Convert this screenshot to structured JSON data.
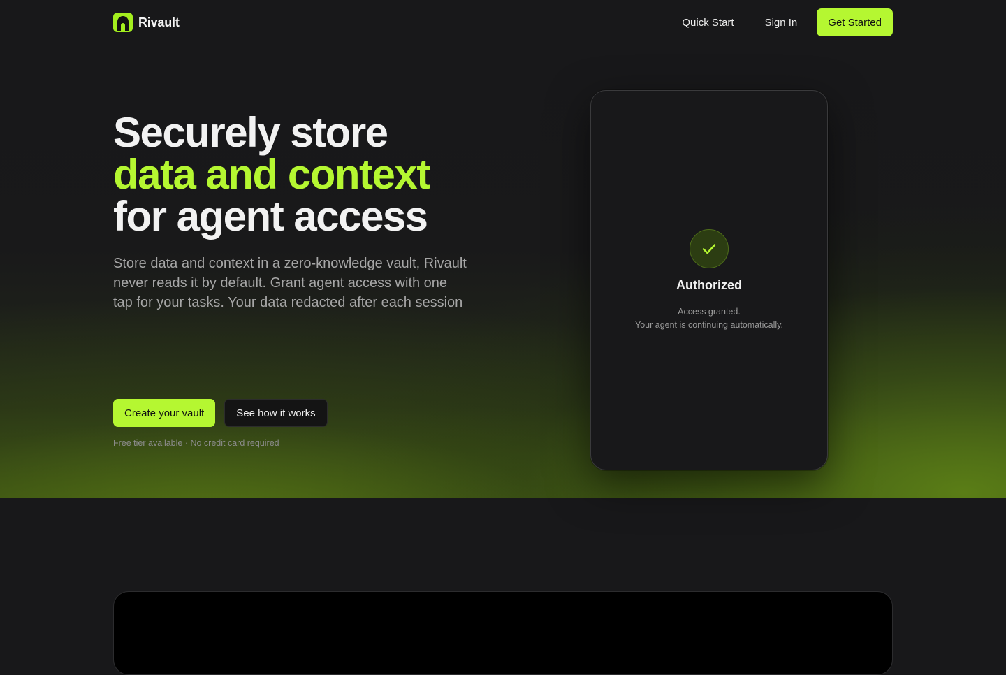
{
  "nav": {
    "brand": "Rivault",
    "links": [
      {
        "label": "Quick Start"
      },
      {
        "label": "Sign In"
      }
    ],
    "cta": "Get Started"
  },
  "hero": {
    "headline_line1": "Securely store",
    "headline_line2": "data and context",
    "headline_line3": "for agent access",
    "subtitle": "Store data and context in a zero-knowledge vault, Rivault never reads it by default. Grant agent access with one tap for your tasks. Your data redacted after each session",
    "primary_cta": "Create your vault",
    "secondary_cta": "See how it works",
    "fineprint": "Free tier available · No credit card required"
  },
  "device": {
    "status_icon": "check-icon",
    "title": "Authorized",
    "message_line1": "Access granted.",
    "message_line2": "Your agent is continuing automatically."
  },
  "colors": {
    "accent": "#b5f731",
    "background": "#18181a"
  }
}
